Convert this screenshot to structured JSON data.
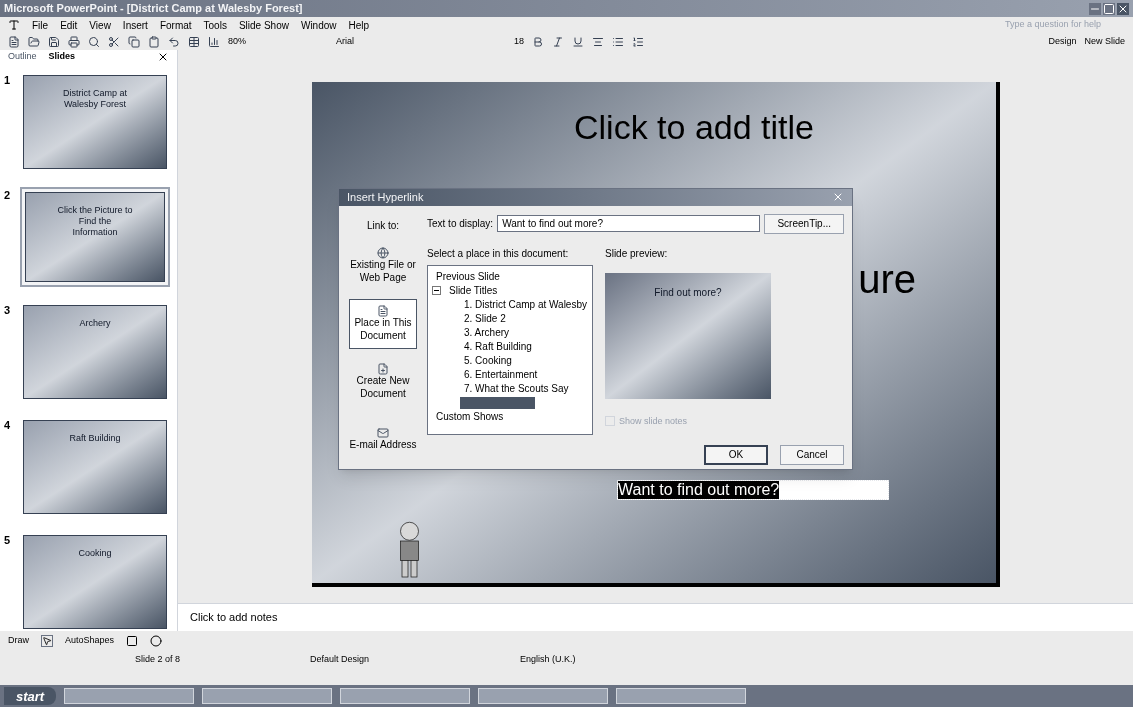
{
  "window": {
    "title": "Microsoft PowerPoint - [District Camp at Walesby Forest]"
  },
  "menu": [
    "File",
    "Edit",
    "View",
    "Insert",
    "Format",
    "Tools",
    "Slide Show",
    "Window",
    "Help"
  ],
  "help_box": {
    "placeholder": "Type a question for help"
  },
  "toolbar": {
    "zoom": "80%",
    "font": "Arial",
    "size": "18",
    "design": "Design",
    "new_slide": "New Slide"
  },
  "pane_tabs": [
    {
      "label": "Outline",
      "selected": false
    },
    {
      "label": "Slides",
      "selected": true
    }
  ],
  "thumbnails": [
    {
      "number": "1",
      "title": "District Camp at Walesby Forest",
      "selected": false
    },
    {
      "number": "2",
      "title": "Click the Picture to Find the Information",
      "selected": true
    },
    {
      "number": "3",
      "title": "Archery",
      "selected": false
    },
    {
      "number": "4",
      "title": "Raft Building",
      "selected": false
    },
    {
      "number": "5",
      "title": "Cooking",
      "selected": false
    }
  ],
  "slide": {
    "title": "Click to add title",
    "partial_text": "ure",
    "link_text": "Want to find out more?"
  },
  "dialog": {
    "title": "Insert Hyperlink",
    "link_to": "Link to:",
    "nav": [
      {
        "label": "Existing File or Web Page",
        "selected": false
      },
      {
        "label": "Place in This Document",
        "selected": true
      },
      {
        "label": "Create New Document",
        "selected": false
      },
      {
        "label": "E-mail Address",
        "selected": false
      }
    ],
    "text_label": "Text to display:",
    "text_value": "Want to find out more?",
    "screentip": "ScreenTip...",
    "place_label": "Select a place in this document:",
    "tree": [
      {
        "label": "Previous Slide"
      },
      {
        "label": "Slide Titles",
        "expanded": true,
        "children": [
          {
            "label": "1. District Camp at Walesby",
            "selected": false
          },
          {
            "label": "2. Slide 2",
            "selected": false
          },
          {
            "label": "3. Archery",
            "selected": false
          },
          {
            "label": "4. Raft Building",
            "selected": false
          },
          {
            "label": "5. Cooking",
            "selected": false
          },
          {
            "label": "6. Entertainment",
            "selected": false
          },
          {
            "label": "7. What the Scouts Say",
            "selected": false
          },
          {
            "selected": true
          }
        ]
      },
      {
        "label": "Custom Shows"
      }
    ],
    "preview_label": "Slide preview:",
    "preview_title": "Find out more?",
    "notes_check": {
      "label": "Show slide notes",
      "checked": false,
      "disabled": true
    },
    "ok": "OK",
    "cancel": "Cancel"
  },
  "notes": {
    "placeholder": "Click to add notes"
  },
  "drawing": {
    "draw": "Draw",
    "autoshapes": "AutoShapes"
  },
  "status_bar": [
    "Slide 2 of 8",
    "Default Design",
    "English (U.K.)"
  ],
  "taskbar": {
    "start": "start"
  }
}
